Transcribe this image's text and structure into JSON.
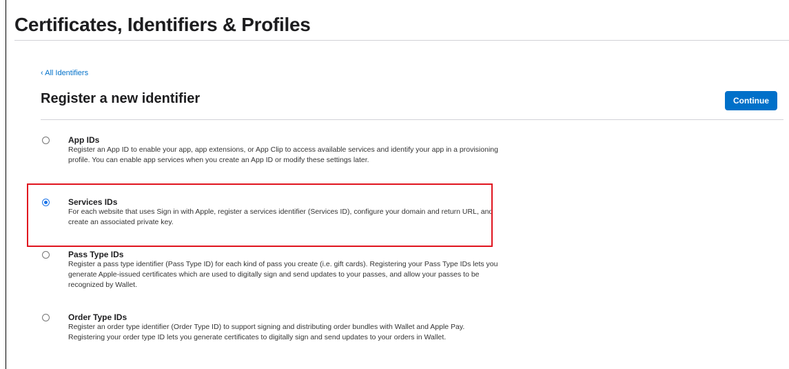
{
  "header": {
    "title": "Certificates, Identifiers & Profiles"
  },
  "nav": {
    "back_link": "‹ All Identifiers"
  },
  "section": {
    "title": "Register a new identifier",
    "continue_label": "Continue"
  },
  "options": [
    {
      "title": "App IDs",
      "description": "Register an App ID to enable your app, app extensions, or App Clip to access available services and identify your app in a provisioning profile. You can enable app services when you create an App ID or modify these settings later.",
      "selected": false
    },
    {
      "title": "Services IDs",
      "description": "For each website that uses Sign in with Apple, register a services identifier (Services ID), configure your domain and return URL, and create an associated private key.",
      "selected": true
    },
    {
      "title": "Pass Type IDs",
      "description": "Register a pass type identifier (Pass Type ID) for each kind of pass you create (i.e. gift cards). Registering your Pass Type IDs lets you generate Apple-issued certificates which are used to digitally sign and send updates to your passes, and allow your passes to be recognized by Wallet.",
      "selected": false
    },
    {
      "title": "Order Type IDs",
      "description": "Register an order type identifier (Order Type ID) to support signing and distributing order bundles with Wallet and Apple Pay. Registering your order type ID lets you generate certificates to digitally sign and send updates to your orders in Wallet.",
      "selected": false
    }
  ],
  "colors": {
    "accent": "#0070c9",
    "radio_selected": "#1a73e8",
    "highlight_box": "#e0141e"
  }
}
